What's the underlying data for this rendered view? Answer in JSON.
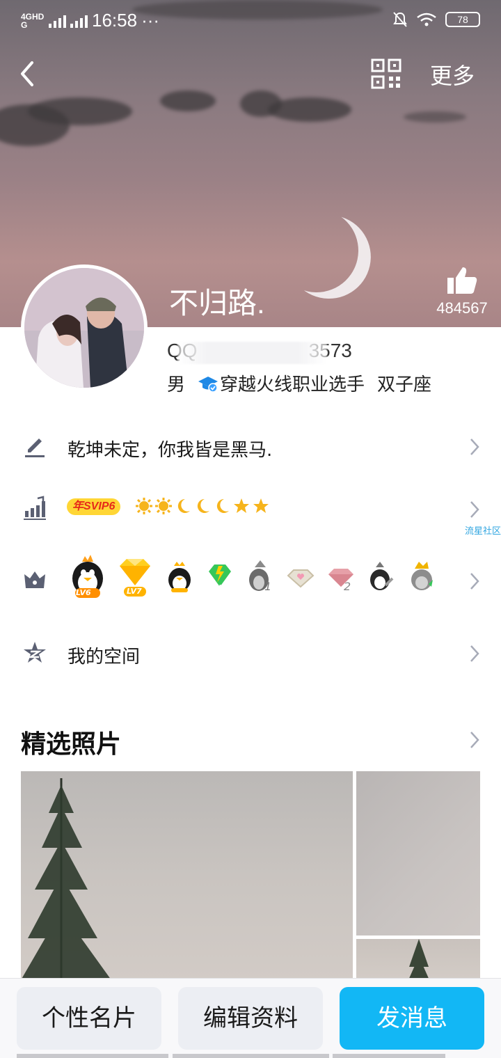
{
  "status_bar": {
    "network_label": "4GHD G",
    "time": "16:58",
    "dots": "···",
    "battery": "78"
  },
  "header": {
    "more_label": "更多",
    "nickname": "不归路.",
    "like_count": "484567"
  },
  "profile": {
    "qq_number_prefix": "QQ",
    "qq_number_suffix": "3573",
    "gender": "男",
    "occupation": "穿越火线职业选手",
    "zodiac": "双子座"
  },
  "rows": {
    "signature": "乾坤未定，你我皆是黑马.",
    "svip_badge": "年SVIP6",
    "community_link": "流星社区",
    "qzone": "我的空间"
  },
  "badges": {
    "lv6": "LV6",
    "lv7": "LV7",
    "lv1": "LV1",
    "num1": "1",
    "num2": "2"
  },
  "photos_section": {
    "title": "精选照片"
  },
  "bottom_bar": {
    "card_label": "个性名片",
    "edit_label": "编辑资料",
    "message_label": "发消息"
  },
  "colors": {
    "accent_blue": "#12b7f5",
    "gray_button": "#eceef3",
    "icon_gray": "#5b6073",
    "svip_yellow": "#ffd635"
  },
  "icons": [
    "back-icon",
    "qr-code-icon",
    "thumbs-up-icon",
    "graduation-cap-icon",
    "pencil-icon",
    "chart-up-icon",
    "crown-icon",
    "qzone-star-icon",
    "chevron-right-icon"
  ]
}
